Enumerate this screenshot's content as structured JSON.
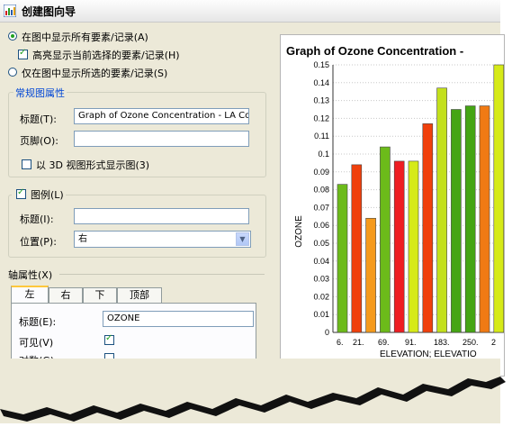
{
  "title": "创建图向导",
  "options": {
    "show_all": "在图中显示所有要素/记录(A)",
    "highlight": "高亮显示当前选择的要素/记录(H)",
    "show_selected": "仅在图中显示所选的要素/记录(S)"
  },
  "general": {
    "legend": "常规图属性",
    "title_label": "标题(T):",
    "title_value": "Graph of Ozone Concentration - LA Co",
    "footer_label": "页脚(O):",
    "footer_value": "",
    "show3d_label": "以 3D 视图形式显示图(3)"
  },
  "legend_group": {
    "label": "图例(L)",
    "title_label": "标题(I):",
    "title_value": "",
    "position_label": "位置(P):",
    "position_value": "右"
  },
  "axis": {
    "label": "轴属性(X)",
    "tabs": [
      "左",
      "右",
      "下",
      "顶部"
    ],
    "title_label": "标题(E):",
    "title_value": "OZONE",
    "visible_label": "可见(V)",
    "log_label": "对数(G)"
  },
  "chart_data": {
    "type": "bar",
    "title": "Graph of Ozone Concentration -",
    "ylabel": "OZONE",
    "xlabel": "ELEVATION; ELEVATIO",
    "ylim": [
      0,
      0.15
    ],
    "yticks": [
      "0",
      "0.01",
      "0.02",
      "0.03",
      "0.04",
      "0.05",
      "0.06",
      "0.07",
      "0.08",
      "0.09",
      "0.1",
      "0.11",
      "0.12",
      "0.13",
      "0.14",
      "0.15"
    ],
    "xticks": [
      "6.",
      "21.",
      "69.",
      "91.",
      "183.",
      "250.",
      "2"
    ],
    "values": [
      0.083,
      0.094,
      0.064,
      0.104,
      0.096,
      0.096,
      0.117,
      0.137,
      0.125,
      0.127,
      0.127,
      0.15
    ],
    "colors": [
      "#6cbb1a",
      "#f0400c",
      "#f59a1b",
      "#6cbb1a",
      "#ee1d23",
      "#d6ea18",
      "#f0400c",
      "#c3e01b",
      "#45a514",
      "#45a514",
      "#f07a14",
      "#d6ea18"
    ]
  }
}
